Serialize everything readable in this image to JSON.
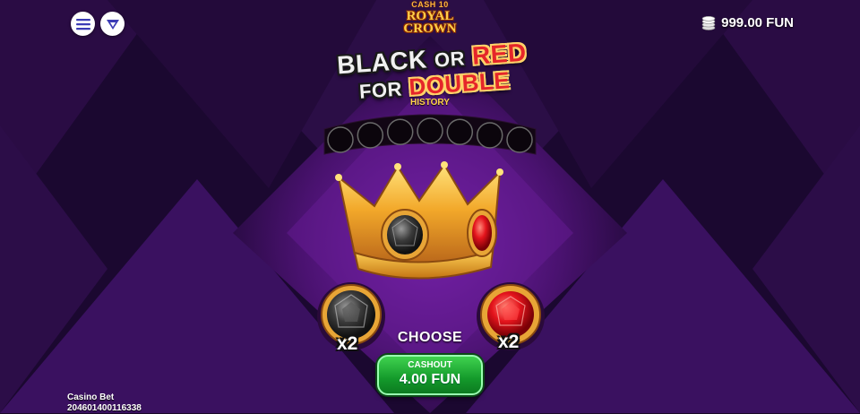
{
  "header": {
    "menu_icon": "hamburger-menu-icon",
    "brand_icon": "brand-logo-icon",
    "balance": "999.00 FUN",
    "balance_icon": "coin-stack-icon"
  },
  "logo": {
    "small_text": "CASH 10",
    "big_text_line1": "ROYAL",
    "big_text_line2": "CROWN"
  },
  "headline": {
    "word_black": "BLACK",
    "word_or": "OR",
    "word_red": "RED",
    "word_for": "FOR",
    "word_double": "DOUBLE"
  },
  "history": {
    "label": "HISTORY",
    "slots": 7
  },
  "gamble": {
    "black_multiplier": "x2",
    "red_multiplier": "x2",
    "choose_label": "CHOOSE"
  },
  "cashout": {
    "label": "CASHOUT",
    "amount": "4.00 FUN"
  },
  "footer": {
    "title": "Casino Bet",
    "id": "204601400116338"
  },
  "colors": {
    "background": "#1a0828",
    "purple": "#6a1c9a",
    "gold": "#f2b531",
    "red_gem": "#e5141c",
    "black_gem": "#3a3a3a",
    "cashout_green": "#149a2b"
  }
}
